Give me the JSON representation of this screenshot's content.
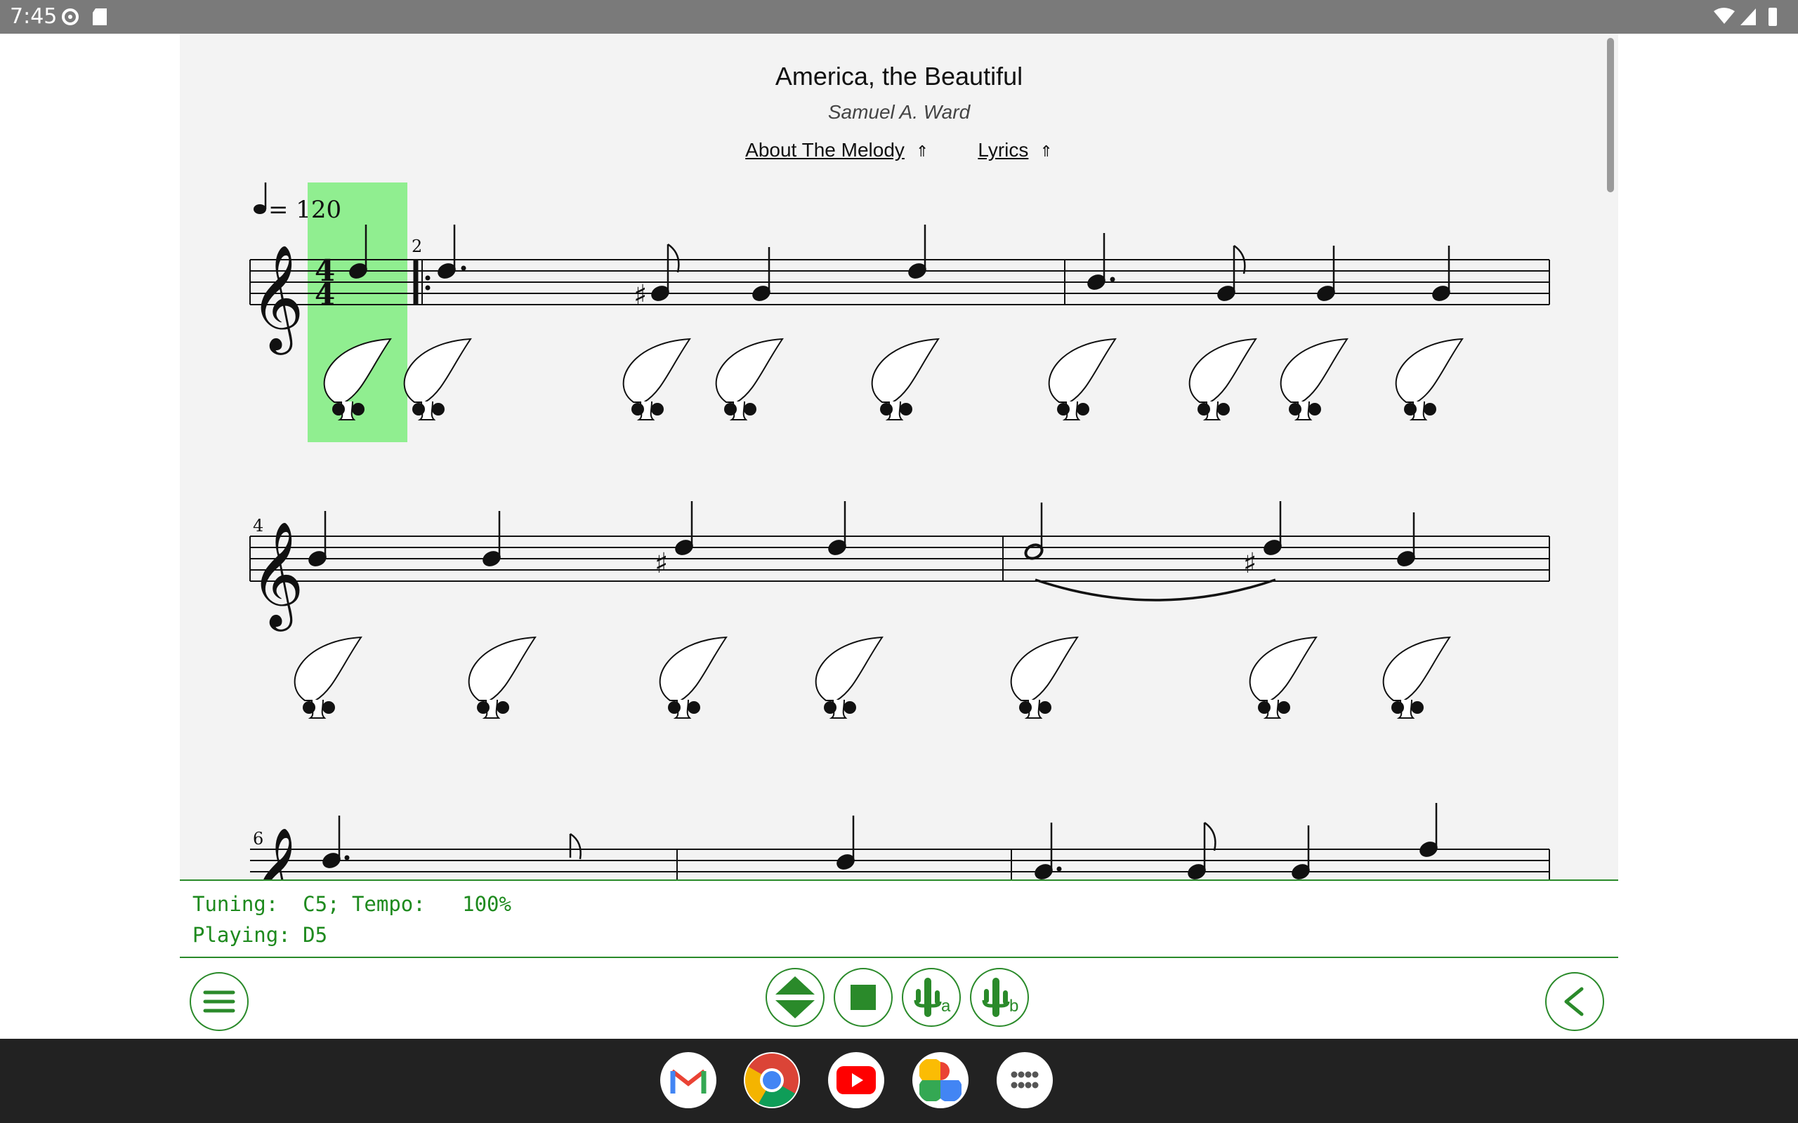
{
  "status_bar": {
    "time": "7:45",
    "left_icons": [
      "settings-icon",
      "sd-card-icon"
    ],
    "right_icons": [
      "wifi-icon",
      "signal-icon",
      "battery-icon"
    ]
  },
  "song": {
    "title": "America, the Beautiful",
    "composer": "Samuel A. Ward",
    "links": [
      {
        "label": "About The Melody",
        "arrow": "⇑"
      },
      {
        "label": "Lyrics",
        "arrow": "⇑"
      }
    ]
  },
  "score": {
    "tempo_mark": "= 120",
    "time_signature": [
      "4",
      "4"
    ],
    "measure_numbers": [
      "2",
      "4",
      "6"
    ],
    "highlight_color": "#90ee90"
  },
  "info": {
    "line1": "Tuning:  C5; Tempo:   100%",
    "line2": "Playing: D5"
  },
  "controls": {
    "left": "menu-icon",
    "center": [
      "scroll-toggle-icon",
      "stop-icon",
      "ocarina-a-icon",
      "ocarina-b-icon"
    ],
    "right": "back-icon",
    "accent": "#2a8a2a",
    "badge_a": "a",
    "badge_b": "b"
  },
  "taskbar": {
    "apps": [
      "gmail-icon",
      "chrome-icon",
      "youtube-icon",
      "photos-icon",
      "app-drawer-icon"
    ]
  }
}
